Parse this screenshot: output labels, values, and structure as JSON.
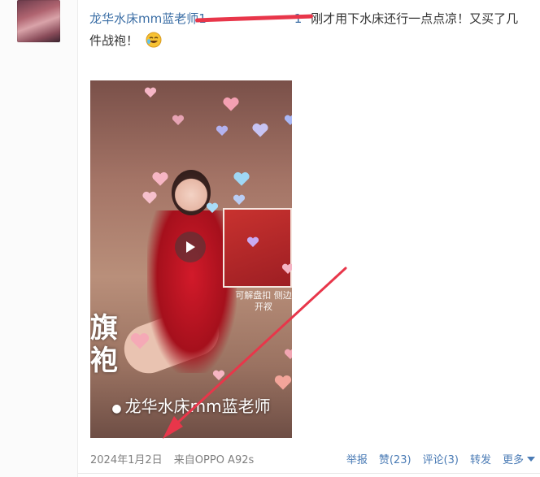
{
  "post": {
    "author": "龙华水床mm蓝老师",
    "phone_fragment": "1",
    "phone_tail": "1",
    "body_text": "刚才用下水床还行一点点凉！又买了几件战袍！",
    "emoji": "laughing-crying-emoji"
  },
  "media": {
    "type": "video",
    "side_caption": "可解盘扣 侧边开衩",
    "big_char": "旗袍",
    "watermark": "龙华水床mm蓝老师",
    "watermark_dot": "●"
  },
  "meta": {
    "date": "2024年1月2日",
    "source": "来自OPPO A92s"
  },
  "actions": {
    "report": "举报",
    "like": "赞(23)",
    "comment": "评论(3)",
    "repost": "转发",
    "more": "更多"
  },
  "colors": {
    "link": "#3b6ea5",
    "action": "#4a7bb5",
    "annotation_arrow": "#e8364a"
  }
}
